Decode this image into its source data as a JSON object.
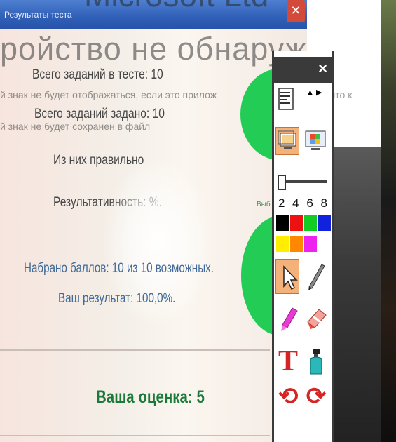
{
  "window": {
    "title": "Результаты теста",
    "close_glyph": "✕"
  },
  "ghost": {
    "title": "Microsoft Ltd",
    "heading": "ройство не обнаружено",
    "line1_left": "й знак не будет отображаться, если это прилож",
    "line1_right": "ужит, что к",
    "line2": "й знак не будет сохранен в файл"
  },
  "stats": {
    "total_tasks": "Всего заданий в тесте:   10",
    "tasks_given": "Всего заданий задано:   10",
    "correct": "Из них правильно",
    "effectiveness": "Результативность:          %."
  },
  "score": {
    "points": "Набрано баллов: 10 из 10 возможных.",
    "result": "Ваш результат: 100,0%."
  },
  "grade": "Ваша оценка: 5",
  "circle_label": "Выб",
  "toolbar": {
    "close_glyph": "×",
    "arrows": "▲  ▶",
    "widths": "2 4 6 8",
    "colors": [
      "#000000",
      "#ee1111",
      "#11cc22",
      "#1122dd",
      "#ffee00",
      "#ff8800",
      "#ee22ee"
    ]
  }
}
